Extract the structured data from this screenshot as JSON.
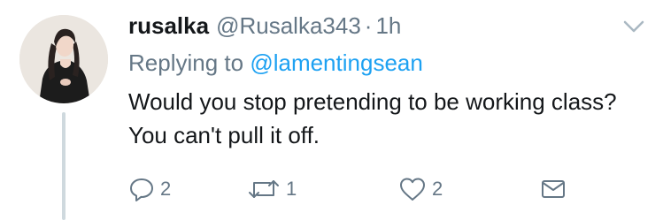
{
  "tweet": {
    "display_name": "rusalka",
    "handle": "@Rusalka343",
    "separator": "·",
    "time": "1h",
    "replying_prefix": "Replying to",
    "replying_to": "@lamentingsean",
    "text": "Would you stop pretending to be working class? You can't pull it off.",
    "actions": {
      "reply_count": "2",
      "retweet_count": "1",
      "like_count": "2"
    }
  },
  "icons": {
    "menu": "chevron-down-icon",
    "reply": "speech-bubble-icon",
    "retweet": "retweet-icon",
    "like": "heart-icon",
    "dm": "envelope-icon"
  },
  "colors": {
    "text": "#14171a",
    "secondary": "#657786",
    "link": "#1da1f2",
    "thread_line": "#cfd9de"
  }
}
